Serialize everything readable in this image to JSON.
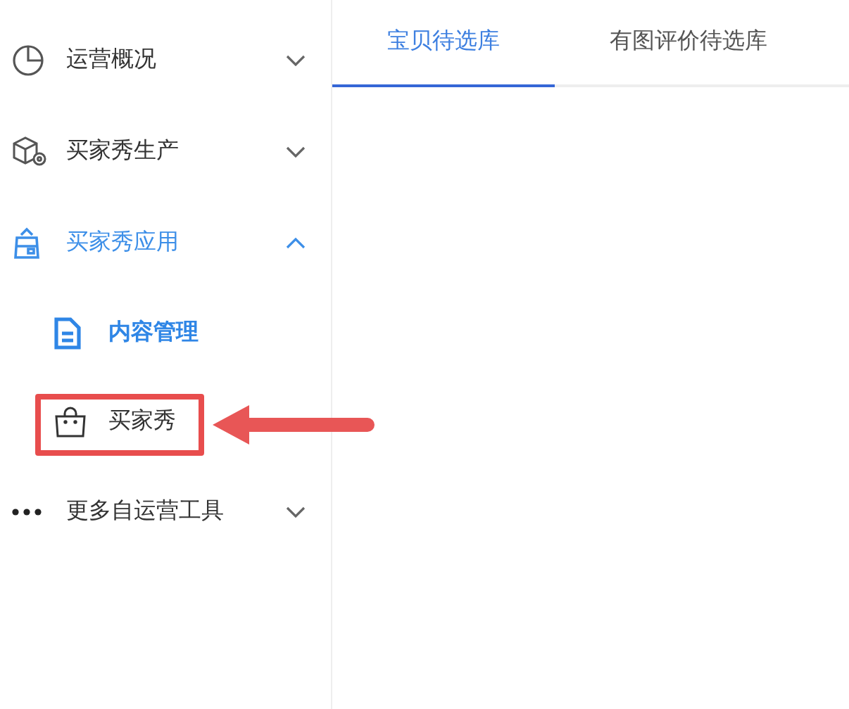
{
  "sidebar": {
    "items": [
      {
        "label": "运营概况",
        "expanded": false
      },
      {
        "label": "买家秀生产",
        "expanded": false
      },
      {
        "label": "买家秀应用",
        "expanded": true,
        "children": [
          {
            "label": "内容管理",
            "kind": "group",
            "highlighted": false
          },
          {
            "label": "买家秀",
            "kind": "link",
            "highlighted": true
          }
        ]
      },
      {
        "label": "更多自运营工具",
        "expanded": false
      }
    ]
  },
  "tabs": [
    {
      "label": "宝贝待选库",
      "selected": true
    },
    {
      "label": "有图评价待选库",
      "selected": false
    }
  ]
}
